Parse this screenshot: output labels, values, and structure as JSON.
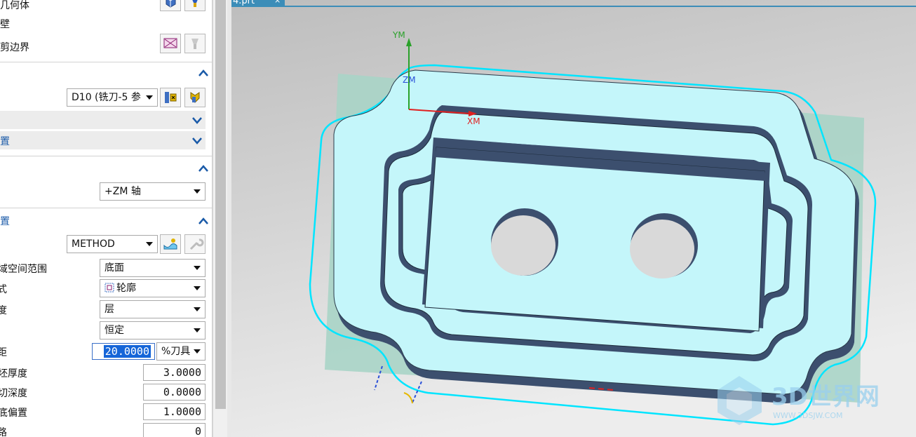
{
  "tab": {
    "label": "4.prt",
    "close": "×"
  },
  "panel": {
    "geometry": {
      "row1_label": "几何体",
      "row2_label": "壁",
      "row3_label": "修剪边界"
    },
    "tool": {
      "value": "D10 (铣刀-5 参"
    },
    "band1": {
      "label": ""
    },
    "band2": {
      "label": "置"
    },
    "axis": {
      "value": "+ZM 轴"
    },
    "settings": {
      "header": "置",
      "method_value": "METHOD",
      "range_label": "切削区域空间范围",
      "range_label_visible": "域空间范围",
      "range_value": "底面",
      "pattern_label": "式",
      "pattern_value": "轮廓",
      "depth_label": "度",
      "depth_value": "层",
      "const_value": "恒定",
      "step_label": "距",
      "step_value": "20.0000",
      "step_unit": "%刀具",
      "blank_label": "坯厚度",
      "blank_value": "3.0000",
      "cut_label": "切深度",
      "cut_value": "0.0000",
      "offset_label": "底偏置",
      "offset_value": "1.0000",
      "last_label": "路",
      "last_value": "0"
    }
  },
  "viewport": {
    "axis_y": "YM",
    "axis_z": "ZM",
    "axis_x": "XM",
    "watermark_text": "3D世界网",
    "watermark_url": "WWW.3DSJW.COM"
  },
  "colors": {
    "part_top": "#c4f6fa",
    "part_wall": "#3c4f6e",
    "blank": "#a9d4c6",
    "toolpath": "#00e5ff",
    "header_text": "#1a5aa8",
    "tab": "#3c8db8"
  }
}
